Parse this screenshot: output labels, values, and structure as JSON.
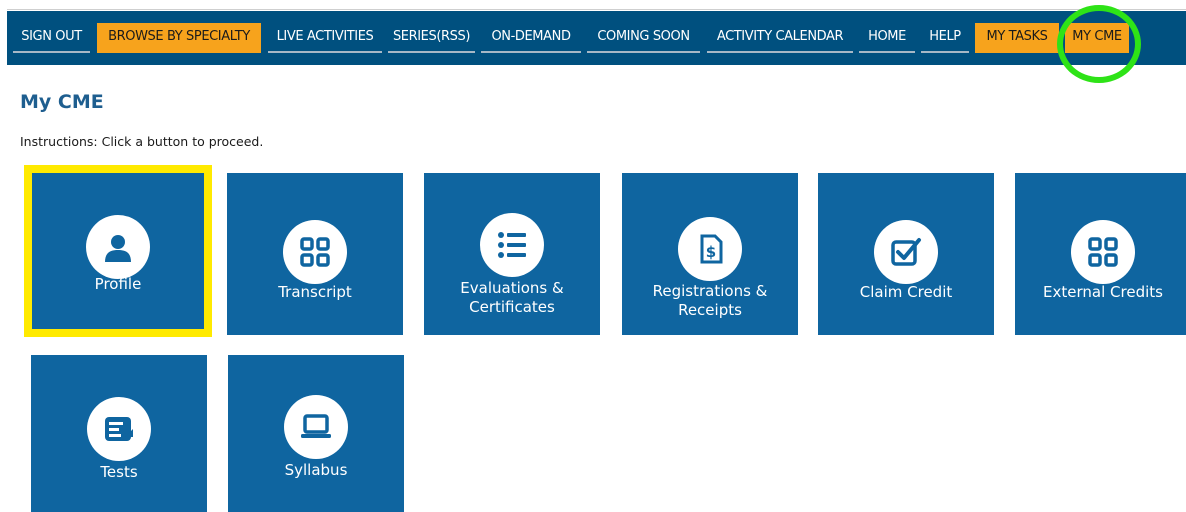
{
  "nav": {
    "items": [
      "SIGN OUT",
      "BROWSE BY SPECIALTY",
      "LIVE ACTIVITIES",
      "SERIES(RSS)",
      "ON-DEMAND",
      "COMING SOON",
      "ACTIVITY CALENDAR",
      "HOME",
      "HELP",
      "MY TASKS",
      "MY CME"
    ],
    "highlighted": [
      "BROWSE BY SPECIALTY",
      "MY TASKS",
      "MY CME"
    ]
  },
  "page": {
    "title": "My CME",
    "instructions": "Instructions: Click a button to proceed."
  },
  "tiles": [
    {
      "label": "Profile",
      "icon": "person-icon",
      "selected": true
    },
    {
      "label": "Transcript",
      "icon": "grid-icon"
    },
    {
      "label": "Evaluations & Certificates",
      "icon": "list-icon"
    },
    {
      "label": "Registrations & Receipts",
      "icon": "receipt-dollar-icon"
    },
    {
      "label": "Claim Credit",
      "icon": "checkbox-icon"
    },
    {
      "label": "External Credits",
      "icon": "grid-icon"
    },
    {
      "label": "Tests",
      "icon": "test-document-icon"
    },
    {
      "label": "Syllabus",
      "icon": "laptop-icon"
    }
  ],
  "colors": {
    "navbar": "#00507f",
    "highlight": "#f7a31c",
    "tile": "#0f65a0",
    "selection_border": "#ffea00",
    "annotation_circle": "#2ee317",
    "title": "#1e5e8f"
  }
}
